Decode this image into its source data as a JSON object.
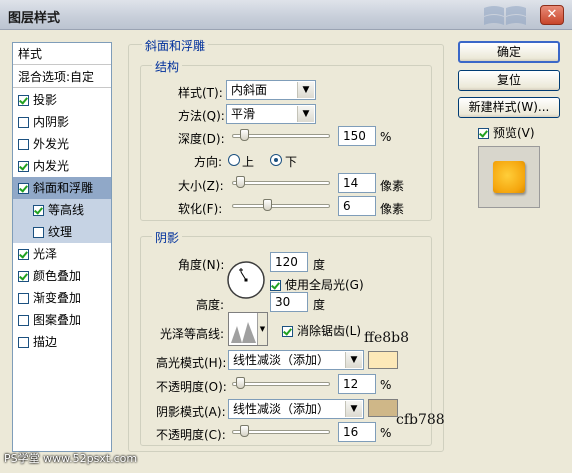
{
  "window": {
    "title": "图层样式",
    "close_glyph": "✕"
  },
  "sidebar": {
    "header": "样式",
    "blend": "混合选项:自定",
    "items": [
      {
        "label": "投影",
        "checked": true
      },
      {
        "label": "内阴影",
        "checked": false
      },
      {
        "label": "外发光",
        "checked": false
      },
      {
        "label": "内发光",
        "checked": true
      },
      {
        "label": "斜面和浮雕",
        "checked": true
      },
      {
        "label": "等高线",
        "checked": true
      },
      {
        "label": "纹理",
        "checked": false
      },
      {
        "label": "光泽",
        "checked": true
      },
      {
        "label": "颜色叠加",
        "checked": true
      },
      {
        "label": "渐变叠加",
        "checked": false
      },
      {
        "label": "图案叠加",
        "checked": false
      },
      {
        "label": "描边",
        "checked": false
      }
    ]
  },
  "panel": {
    "title": "斜面和浮雕",
    "structure": {
      "title": "结构",
      "style_label": "样式(T):",
      "style_value": "内斜面",
      "method_label": "方法(Q):",
      "method_value": "平滑",
      "depth_label": "深度(D):",
      "depth_value": "150",
      "depth_unit": "%",
      "direction_label": "方向:",
      "dir_up": "上",
      "dir_down": "下",
      "size_label": "大小(Z):",
      "size_value": "14",
      "size_unit": "像素",
      "soften_label": "软化(F):",
      "soften_value": "6",
      "soften_unit": "像素"
    },
    "shading": {
      "title": "阴影",
      "angle_label": "角度(N):",
      "angle_value": "120",
      "angle_unit": "度",
      "global_light": "使用全局光(G)",
      "altitude_label": "高度:",
      "altitude_value": "30",
      "altitude_unit": "度",
      "gloss_label": "光泽等高线:",
      "anti_alias": "消除锯齿(L)",
      "highlight_label": "高光模式(H):",
      "highlight_mode": "线性减淡（添加）",
      "highlight_color": "#fce8b8",
      "highlight_opacity_label": "不透明度(O):",
      "highlight_opacity": "12",
      "shadow_label": "阴影模式(A):",
      "shadow_mode": "线性减淡（添加）",
      "shadow_color": "#cfb788",
      "shadow_opacity_label": "不透明度(C):",
      "shadow_opacity": "16",
      "pct": "%"
    }
  },
  "buttons": {
    "ok": "确定",
    "reset": "复位",
    "new_style": "新建样式(W)...",
    "preview": "预览(V)"
  },
  "annotations": {
    "highlight_hex": "ffe8b8",
    "shadow_hex": "cfb788"
  },
  "watermark": "PS学堂 www.52psxt.com"
}
